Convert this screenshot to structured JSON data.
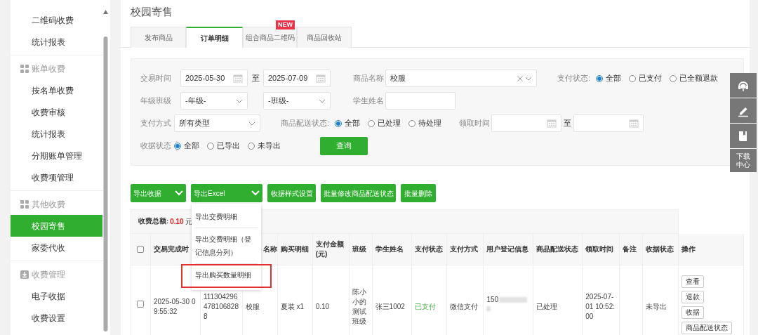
{
  "sidebar": {
    "sections": [
      {
        "items": [
          {
            "label": "二维码收费",
            "selected": false
          },
          {
            "label": "统计报表",
            "selected": false
          }
        ]
      },
      {
        "header": {
          "label": "账单收费"
        },
        "items": [
          {
            "label": "按名单收费",
            "selected": false
          },
          {
            "label": "收费审核",
            "selected": false
          },
          {
            "label": "统计报表",
            "selected": false
          },
          {
            "label": "分期账单管理",
            "selected": false
          },
          {
            "label": "收费项管理",
            "selected": false
          }
        ]
      },
      {
        "header": {
          "label": "其他收费"
        },
        "items": [
          {
            "label": "校园寄售",
            "selected": true
          },
          {
            "label": "家委代收",
            "selected": false
          }
        ]
      },
      {
        "header": {
          "label": "收费管理"
        },
        "items": [
          {
            "label": "电子收据",
            "selected": false
          },
          {
            "label": "收费设置",
            "selected": false
          }
        ]
      }
    ]
  },
  "page_title": "校园寄售",
  "tabs": [
    {
      "label": "发布商品",
      "selected": false
    },
    {
      "label": "订单明细",
      "selected": true
    },
    {
      "label": "组合商品二维码",
      "selected": false,
      "badge": "NEW"
    },
    {
      "label": "商品回收站",
      "selected": false
    }
  ],
  "filters": {
    "trade_time": {
      "label": "交易时间",
      "from": "2025-05-30",
      "separator": "至",
      "to": "2025-07-09"
    },
    "product_name": {
      "label": "商品名称",
      "value": "校服"
    },
    "pay_status": {
      "label": "支付状态:",
      "options": [
        {
          "label": "全部",
          "selected": true
        },
        {
          "label": "已支付",
          "selected": false
        },
        {
          "label": "已全额退款",
          "selected": false
        }
      ]
    },
    "grade_class": {
      "label": "年级班级",
      "grade": "-年级-",
      "class": "-班级-"
    },
    "student_name": {
      "label": "学生姓名"
    },
    "pay_method": {
      "label": "支付方式",
      "value": "所有类型"
    },
    "delivery_status": {
      "label": "商品配送状态:",
      "options": [
        {
          "label": "全部",
          "selected": true
        },
        {
          "label": "已处理",
          "selected": false
        },
        {
          "label": "待处理",
          "selected": false
        }
      ]
    },
    "pickup_time": {
      "label": "领取时间",
      "separator": "至"
    },
    "receipt_status": {
      "label": "收据状态",
      "options": [
        {
          "label": "全部",
          "selected": true
        },
        {
          "label": "已导出",
          "selected": false
        },
        {
          "label": "未导出",
          "selected": false
        }
      ]
    },
    "query_button": "查询"
  },
  "actions": [
    {
      "label": "导出收据",
      "dropdown": true
    },
    {
      "label": "导出Excel",
      "dropdown": true
    },
    {
      "label": "收据样式设置"
    },
    {
      "label": "批量修改商品配送状态"
    },
    {
      "label": "批量删除"
    }
  ],
  "export_menu": {
    "items": [
      {
        "label": "导出交费明细",
        "highlighted": false
      },
      {
        "label": "导出交费明细（登记信息分列）",
        "highlighted": false
      },
      {
        "label": "导出购买数量明细",
        "highlighted": true
      }
    ]
  },
  "table": {
    "summary": {
      "label": "收费总额:",
      "amount": "0.10",
      "unit": "元"
    },
    "select_all_checked": false,
    "columns": [
      "交易完成时",
      "",
      "名称",
      "购买明细",
      "支付金额(元)",
      "班级",
      "学生姓名",
      "支付状态",
      "支付方式",
      "用户登记信息",
      "商品配送状态",
      "领取时间",
      "备注",
      "收据状态",
      "操作"
    ],
    "rows": [
      {
        "checked": false,
        "cells": [
          {
            "kind": "text",
            "text": "2025-05-30 09:55:32"
          },
          {
            "kind": "text",
            "text": "1113042964781068288"
          },
          {
            "kind": "text",
            "text": "校服"
          },
          {
            "kind": "text",
            "text": "夏装 x1"
          },
          {
            "kind": "text",
            "text": "0.10"
          },
          {
            "kind": "text",
            "text": "陈小小的测试班级"
          },
          {
            "kind": "text",
            "text": "张三1002"
          },
          {
            "kind": "status",
            "text": "已支付"
          },
          {
            "kind": "text",
            "text": "微信支付"
          },
          {
            "kind": "masked",
            "text": "150"
          },
          {
            "kind": "text",
            "text": "已处理"
          },
          {
            "kind": "text",
            "text": "2025-07-01 10:52:00"
          },
          {
            "kind": "empty"
          },
          {
            "kind": "text",
            "text": "未导出"
          },
          {
            "kind": "actions",
            "buttons": [
              "查看",
              "退款",
              "收据",
              "商品配送状态"
            ]
          }
        ]
      }
    ]
  },
  "side_tools": [
    {
      "kind": "support"
    },
    {
      "kind": "edit"
    },
    {
      "kind": "guide"
    },
    {
      "kind": "text",
      "label": "下载中心"
    }
  ]
}
